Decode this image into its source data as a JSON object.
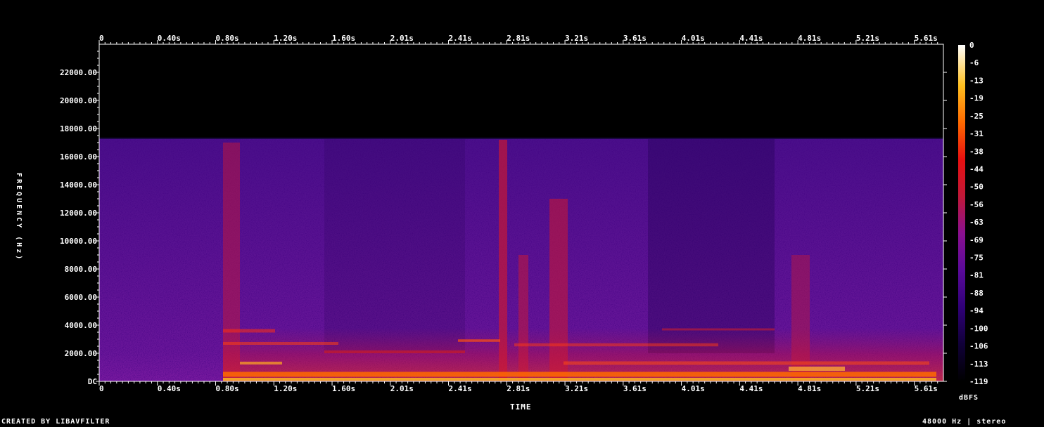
{
  "chart_data": {
    "type": "heatmap",
    "xlabel": "TIME",
    "ylabel": "FREQUENCY (Hz)",
    "x_ticks": [
      "0",
      "0.40s",
      "0.80s",
      "1.20s",
      "1.60s",
      "2.01s",
      "2.41s",
      "2.81s",
      "3.21s",
      "3.61s",
      "4.01s",
      "4.41s",
      "4.81s",
      "5.21s",
      "5.61s"
    ],
    "y_ticks": [
      "DC",
      "2000.00",
      "4000.00",
      "6000.00",
      "8000.00",
      "10000.00",
      "12000.00",
      "14000.00",
      "16000.00",
      "18000.00",
      "20000.00",
      "22000.00"
    ],
    "x_range_s": [
      0,
      6.0
    ],
    "y_range_hz": [
      0,
      24000
    ],
    "content_cutoff_hz": 17300,
    "colorbar": {
      "label": "dBFS",
      "ticks": [
        "0",
        "-6",
        "-13",
        "-19",
        "-25",
        "-31",
        "-38",
        "-44",
        "-50",
        "-56",
        "-63",
        "-69",
        "-75",
        "-81",
        "-88",
        "-94",
        "-100",
        "-106",
        "-113",
        "-119"
      ],
      "range": [
        -119,
        0
      ],
      "colors": [
        "#000000",
        "#100038",
        "#300078",
        "#5a0a9a",
        "#8a1090",
        "#c01838",
        "#e81010",
        "#ff6a00",
        "#ffc020",
        "#ffffff"
      ]
    }
  },
  "footer": {
    "credit": "CREATED BY LIBAVFILTER",
    "info": "48000 Hz | stereo"
  }
}
